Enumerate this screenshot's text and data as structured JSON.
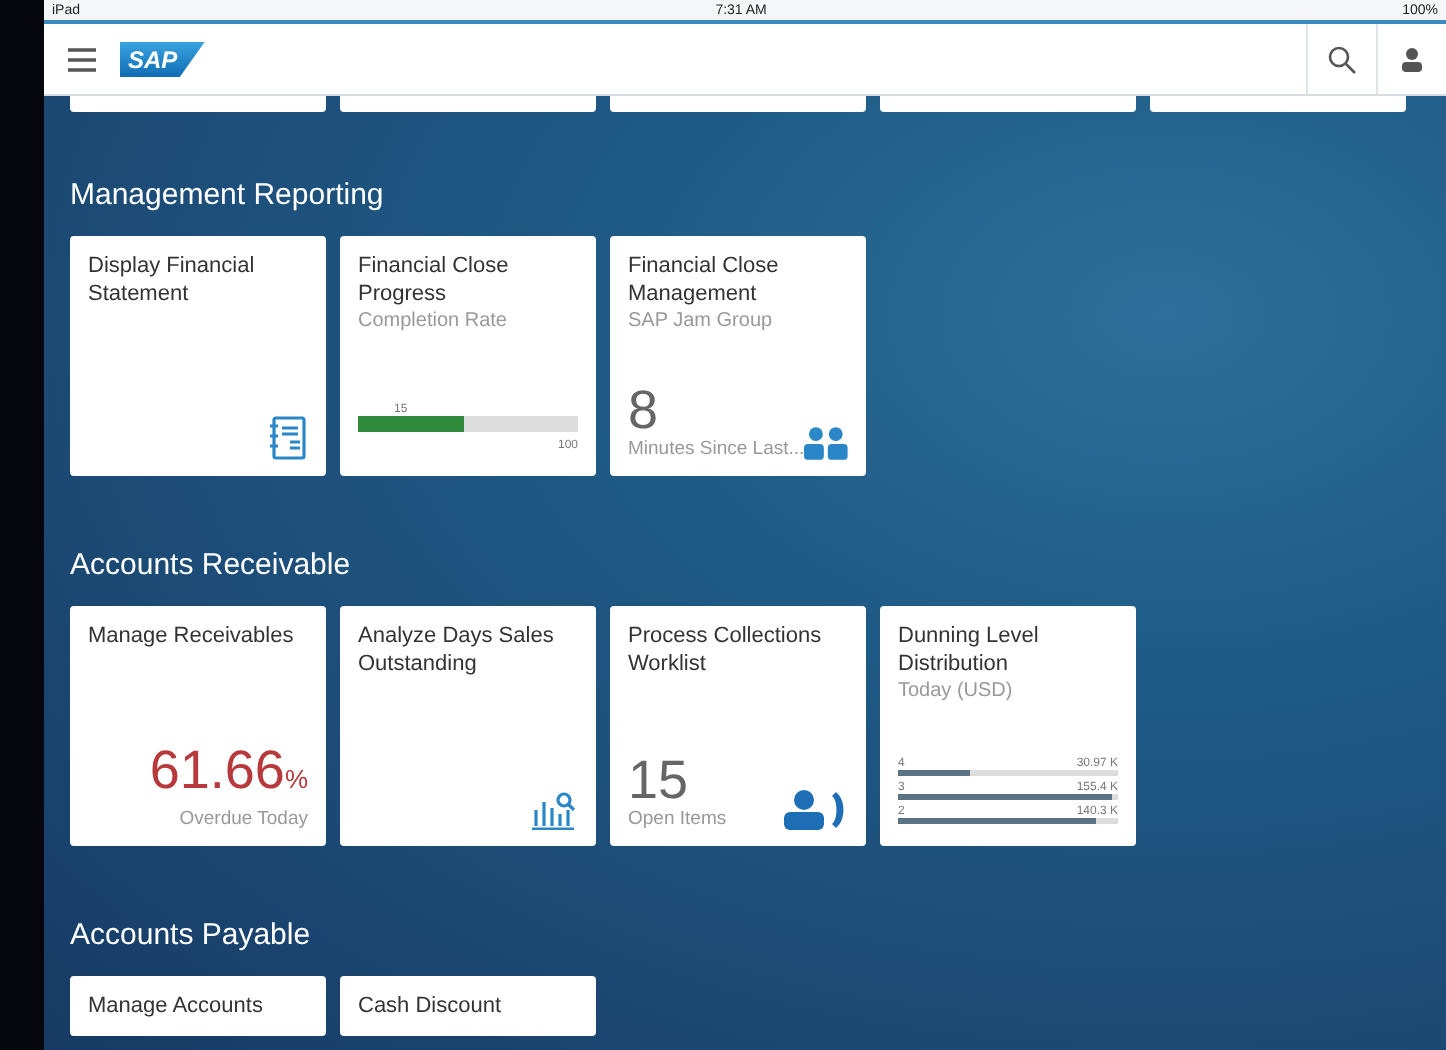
{
  "status_bar": {
    "device": "iPad",
    "time": "7:31 AM",
    "battery": "100%"
  },
  "header": {
    "logo": "SAP"
  },
  "sections": [
    {
      "title": "Management Reporting",
      "tiles": [
        {
          "kind": "icon",
          "title": "Display Financial Statement"
        },
        {
          "kind": "progress",
          "title": "Financial Close Progress",
          "subtitle": "Completion Rate",
          "value_label": "15",
          "max_label": "100",
          "level": 0.48
        },
        {
          "kind": "number",
          "title": "Financial Close Management",
          "subtitle": "SAP Jam Group",
          "number": "8",
          "footer": "Minutes Since Last..."
        }
      ]
    },
    {
      "title": "Accounts Receivable",
      "tiles": [
        {
          "kind": "kpi",
          "title": "Manage Receivables",
          "number": "61.66",
          "unit": "%",
          "footer": "Overdue Today"
        },
        {
          "kind": "icon",
          "title": "Analyze Days Sales Outstanding"
        },
        {
          "kind": "number",
          "title": "Process Collections Worklist",
          "number": "15",
          "footer": "Open Items"
        },
        {
          "kind": "bars",
          "title": "Dunning Level Distribution",
          "subtitle": "Today (USD)",
          "bars": [
            {
              "label": "4",
              "value": "30.97 K",
              "level": 0.33
            },
            {
              "label": "3",
              "value": "155.4 K",
              "level": 0.97
            },
            {
              "label": "2",
              "value": "140.3 K",
              "level": 0.9
            }
          ]
        }
      ]
    },
    {
      "title": "Accounts Payable",
      "tiles": [
        {
          "kind": "cut",
          "title": "Manage Accounts"
        },
        {
          "kind": "cut",
          "title": "Cash Discount"
        }
      ]
    }
  ]
}
